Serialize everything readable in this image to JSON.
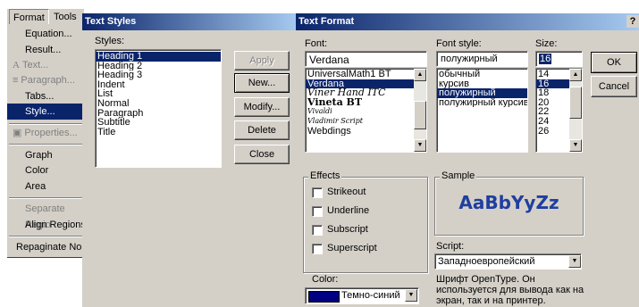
{
  "menubar": {
    "items": [
      "Format",
      "Tools"
    ]
  },
  "format_menu": {
    "items": [
      {
        "label": "Equation...",
        "disabled": false
      },
      {
        "label": "Result...",
        "disabled": false
      },
      {
        "label": "Text...",
        "disabled": true
      },
      {
        "label": "Paragraph...",
        "disabled": true
      },
      {
        "label": "Tabs...",
        "disabled": false
      },
      {
        "label": "Style...",
        "disabled": false,
        "selected": true
      },
      {
        "label": "Properties...",
        "disabled": true
      },
      {
        "label": "Graph",
        "disabled": false
      },
      {
        "label": "Color",
        "disabled": false
      },
      {
        "label": "Area",
        "disabled": false
      },
      {
        "label": "Separate Regio",
        "disabled": true
      },
      {
        "label": "Align Regions",
        "disabled": false
      },
      {
        "label": "Repaginate No",
        "disabled": false
      }
    ]
  },
  "text_styles": {
    "title": "Text Styles",
    "styles_label": "Styles:",
    "styles": [
      "Heading 1",
      "Heading 2",
      "Heading 3",
      "Indent",
      "List",
      "Normal",
      "Paragraph",
      "Subtitle",
      "Title"
    ],
    "selected_index": 0,
    "buttons": {
      "apply": "Apply",
      "new": "New...",
      "modify": "Modify...",
      "delete": "Delete",
      "close": "Close"
    }
  },
  "text_format": {
    "title": "Text Format",
    "font_label": "Font:",
    "font_value": "Verdana",
    "fonts": [
      "UniversalMath1 BT",
      "Verdana",
      "Viner Hand ITC",
      "Vineta BT",
      "Vivaldi",
      "Vladimir Script",
      "Webdings"
    ],
    "font_selected_index": 1,
    "style_label": "Font style:",
    "style_value": "полужирный",
    "styles": [
      "обычный",
      "курсив",
      "полужирный",
      "полужирный курсив"
    ],
    "style_selected_index": 2,
    "size_label": "Size:",
    "size_value": "16",
    "sizes": [
      "14",
      "16",
      "18",
      "20",
      "22",
      "24",
      "26"
    ],
    "size_selected_index": 1,
    "ok": "OK",
    "cancel": "Cancel",
    "effects_label": "Effects",
    "effects": [
      "Strikeout",
      "Underline",
      "Subscript",
      "Superscript"
    ],
    "sample_label": "Sample",
    "sample_text": "AaBbYyZz",
    "sample_color": "#1f3f9f",
    "script_label": "Script:",
    "script_value": "Западноевропейский",
    "color_label": "Color:",
    "color_value": "Темно-синий",
    "color_swatch": "#000080",
    "info_text": "Шрифт OpenType. Он используется для вывода как на экран, так и на принтер.",
    "help_glyph": "?"
  }
}
